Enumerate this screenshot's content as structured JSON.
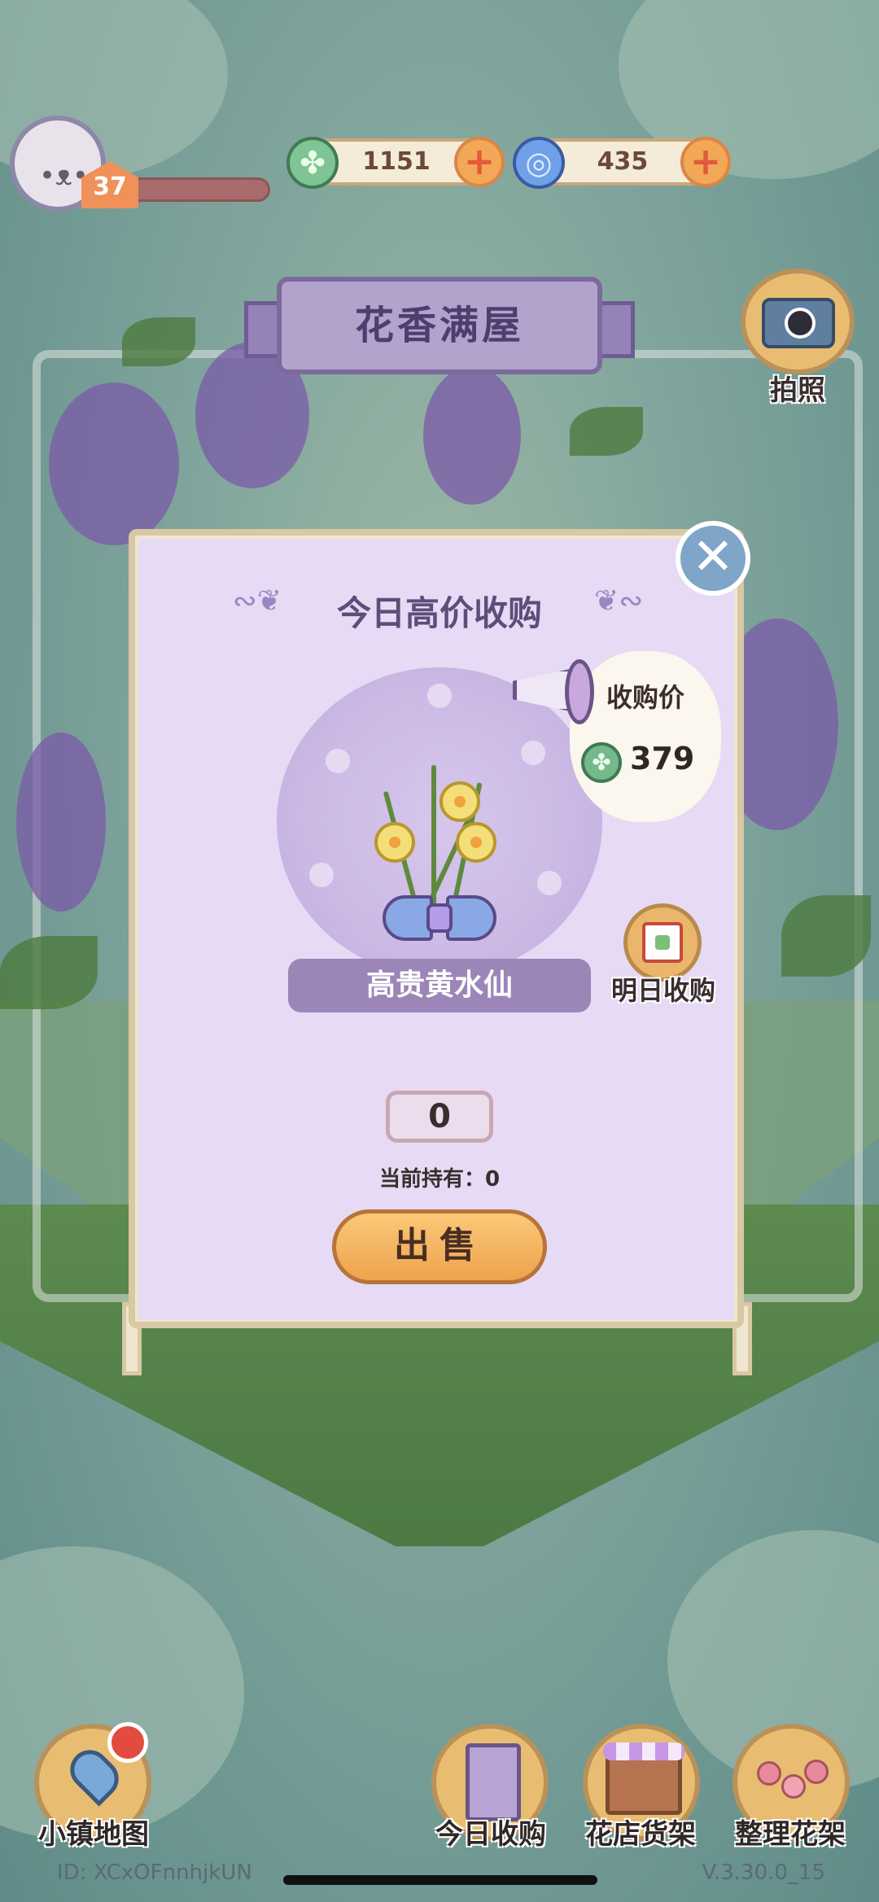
{
  "hud": {
    "level": "37",
    "xp_fraction": 0.04,
    "clover_amount": "1151",
    "orb_amount": "435"
  },
  "camera": {
    "label": "拍照"
  },
  "shop_sign": {
    "title": "花香满屋"
  },
  "modal": {
    "title": "今日高价收购",
    "price_label": "收购价",
    "price_value": "379",
    "flower_name": "高贵黄水仙",
    "tomorrow_label": "明日收购",
    "quantity": "0",
    "holding_text": "当前持有：0",
    "sell_label": "出售"
  },
  "nav": {
    "map": "小镇地图",
    "today": "今日收购",
    "shelf": "花店货架",
    "arrange": "整理花架"
  },
  "footer": {
    "id": "ID:  XCxOFnnhjkUN",
    "version": "V.3.30.0_15"
  },
  "colors": {
    "panel_purple": "#e6daf5",
    "button_orange": "#eea34e",
    "accent_purple": "#9b86b7"
  },
  "icons": [
    "cat-avatar-icon",
    "clover-coin-icon",
    "blue-orb-icon",
    "plus-icon",
    "camera-icon",
    "close-icon",
    "megaphone-icon",
    "calendar-icon",
    "map-pin-icon",
    "shop-sign-icon",
    "shop-stall-icon",
    "flower-pots-icon"
  ]
}
